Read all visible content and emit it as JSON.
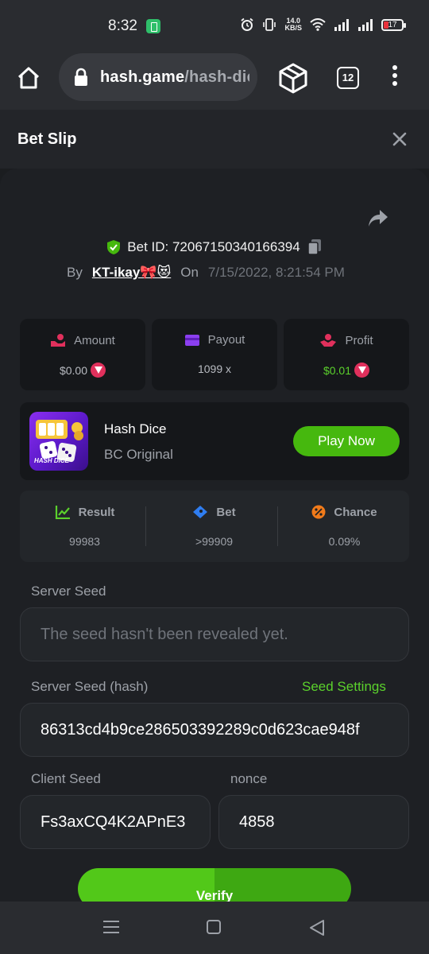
{
  "status_bar": {
    "time": "8:32",
    "net_speed_value": "14.0",
    "net_speed_unit": "KB/S",
    "battery_level": "17"
  },
  "browser": {
    "url_host": "hash.game",
    "url_path": "/hash-dice",
    "tab_count": "12"
  },
  "slip": {
    "title": "Bet Slip",
    "bet_id_label": "Bet ID: 72067150340166394",
    "by_label": "By",
    "user": "KT-ikay🎀😻",
    "on_label": "On",
    "date": "7/15/2022, 8:21:54 PM"
  },
  "stats": [
    {
      "label": "Amount",
      "value": "$0.00",
      "icon": "hand-coin-icon",
      "color": "#e0305c"
    },
    {
      "label": "Payout",
      "value": "1099 x",
      "icon": "wallet-icon",
      "color": "#8b3ff0"
    },
    {
      "label": "Profit",
      "value": "$0.01",
      "icon": "profit-icon",
      "color": "#e0305c"
    }
  ],
  "game": {
    "name": "Hash Dice",
    "subtitle": "BC Original",
    "thumb_label": "HASH DICE",
    "play_label": "Play Now"
  },
  "round": [
    {
      "label": "Result",
      "value": "99983",
      "icon": "chart-icon",
      "color": "#5bd12c"
    },
    {
      "label": "Bet",
      "value": ">99909",
      "icon": "ticket-icon",
      "color": "#2f7df0"
    },
    {
      "label": "Chance",
      "value": "0.09%",
      "icon": "percent-icon",
      "color": "#f07a1a"
    }
  ],
  "seeds": {
    "server_seed_label": "Server Seed",
    "server_seed_placeholder": "The seed hasn't been revealed yet.",
    "server_hash_label": "Server Seed (hash)",
    "seed_settings_label": "Seed Settings",
    "server_hash_value": "86313cd4b9ce286503392289c0d623cae948f",
    "client_seed_label": "Client Seed",
    "client_seed_value": "Fs3axCQ4K2APnE3",
    "nonce_label": "nonce",
    "nonce_value": "4858",
    "verify_label": "Verify"
  },
  "colors": {
    "accent_green": "#46b80e",
    "link_green": "#5bd12c",
    "background": "#1e2024"
  }
}
